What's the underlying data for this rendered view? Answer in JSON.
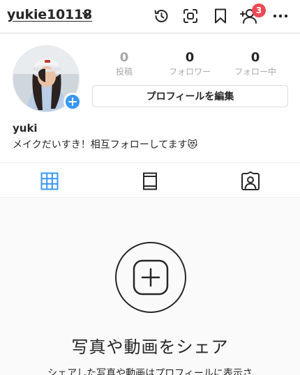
{
  "header": {
    "username": "yukie10118",
    "notification_count": "3"
  },
  "profile": {
    "stats": [
      {
        "value": "0",
        "label": "投稿"
      },
      {
        "value": "0",
        "label": "フォロワー"
      },
      {
        "value": "0",
        "label": "フォロー中"
      }
    ],
    "edit_button_label": "プロフィールを編集",
    "name": "yuki",
    "bio": "メイクだいすき！相互フォローしてます😻"
  },
  "empty_state": {
    "title": "写真や動画をシェア",
    "subtitle": "シェアした写真や動画はプロフィールに表示さ"
  },
  "icons": {
    "dropdown": "chevron-down-icon",
    "archive": "history-icon",
    "scan": "qr-scan-icon",
    "saved": "bookmark-icon",
    "discover": "add-person-icon",
    "more": "more-icon",
    "grid_tab": "grid-icon",
    "igtv_tab": "igtv-icon",
    "tagged_tab": "tagged-icon",
    "add_content": "plus-square-icon"
  },
  "colors": {
    "accent": "#3897f0",
    "badge": "#ed4956",
    "text": "#262626",
    "muted": "#a8a8a8"
  }
}
